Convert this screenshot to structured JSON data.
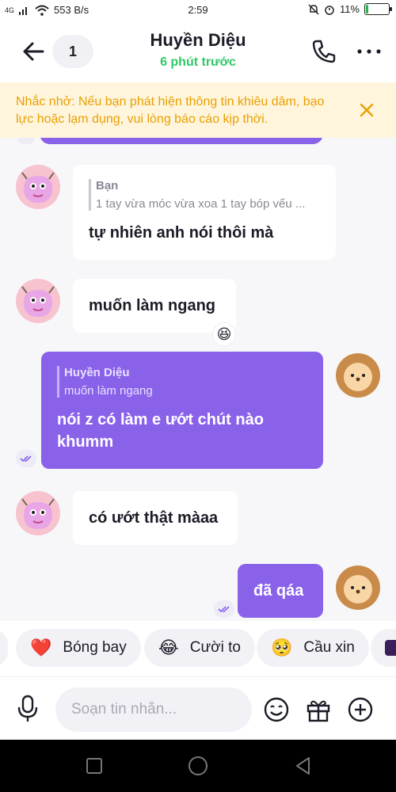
{
  "status_bar": {
    "network": "4G",
    "speed": "553 B/s",
    "time": "2:59",
    "battery": "11%",
    "battery_level": 0.11
  },
  "header": {
    "badge_count": "1",
    "contact_name": "Huyền Diệu",
    "last_seen": "6 phút trước"
  },
  "warning": {
    "text": "Nhắc nhở: Nếu bạn phát hiện thông tin khiêu dâm, bạo lực hoặc lạm dụng, vui lòng báo cáo kịp thời."
  },
  "messages": [
    {
      "sender": "them",
      "quote_name": "Bạn",
      "quote_text": "1 tay vừa móc vừa xoa 1 tay bóp vếu ...",
      "text": "tự nhiên anh nói thôi mà"
    },
    {
      "sender": "them",
      "text": "muốn làm ngang",
      "reaction": "😆"
    },
    {
      "sender": "me",
      "quote_name": "Huyền Diệu",
      "quote_text": "muốn làm ngang",
      "text": "nói z có làm e ướt chút nào khumm"
    },
    {
      "sender": "them",
      "text": "có ướt thật màaa"
    },
    {
      "sender": "me",
      "text": "đã qáa"
    }
  ],
  "quick_reactions": [
    {
      "emoji": "❤️",
      "label": "Bóng bay"
    },
    {
      "emoji": "😂",
      "label": "Cười to"
    },
    {
      "emoji": "🥺",
      "label": "Cầu xin"
    }
  ],
  "composer": {
    "placeholder": "Soạn tin nhắn..."
  },
  "colors": {
    "accent": "#8a62ea",
    "online": "#2ec866",
    "warning_text": "#e9a000",
    "warning_bg": "#fff5dd"
  }
}
